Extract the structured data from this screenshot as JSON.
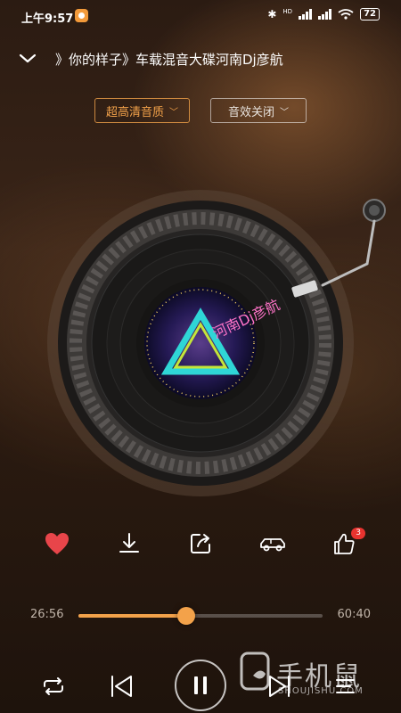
{
  "status": {
    "time": "上午9:57",
    "network": "HD",
    "battery": "72"
  },
  "header": {
    "title": "》你的样子》车载混音大碟河南Dj彦航"
  },
  "quality_selector": {
    "label": "超高清音质"
  },
  "effect_selector": {
    "label": "音效关闭"
  },
  "album_art": {
    "text": "河南Dj彦航"
  },
  "actions": {
    "like_badge": "3"
  },
  "progress": {
    "current": "26:56",
    "total": "60:40",
    "fraction": 0.44
  },
  "watermark": {
    "text": "手机鼠",
    "sub": "SHOUJISHU.COM"
  },
  "colors": {
    "accent": "#f3a24a",
    "like": "#e8454a"
  }
}
